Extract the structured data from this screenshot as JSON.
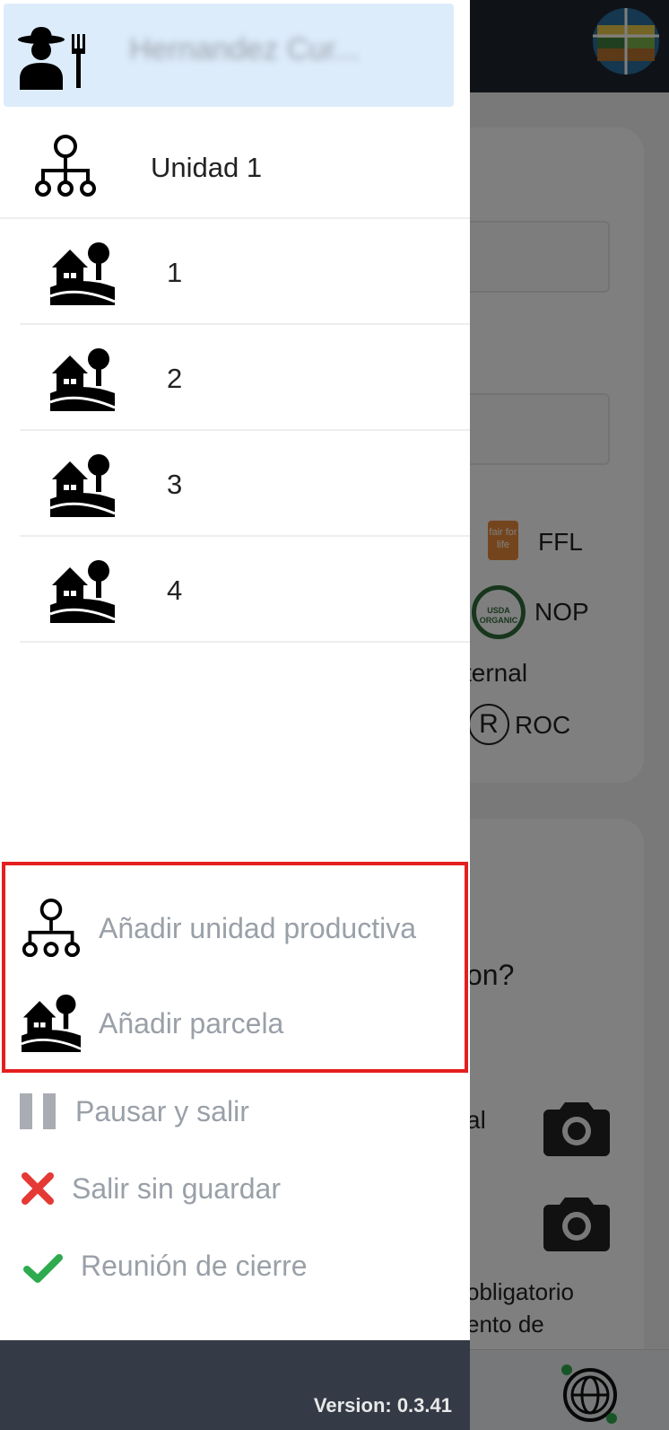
{
  "drawer": {
    "user_name": "Hernandez Cur...",
    "unit": {
      "label": "Unidad 1"
    },
    "plots": [
      {
        "label": "1"
      },
      {
        "label": "2"
      },
      {
        "label": "3"
      },
      {
        "label": "4"
      }
    ],
    "actions": {
      "add_unit": "Añadir unidad productiva",
      "add_plot": "Añadir parcela",
      "pause_exit": "Pausar y salir",
      "exit_no_save": "Salir sin guardar",
      "closing_meeting": "Reunión de cierre"
    },
    "version": "Version: 0.3.41"
  },
  "background": {
    "certifications": [
      {
        "label": "FFL",
        "badge_text": "fair for life"
      },
      {
        "label": "NOP",
        "badge_text": "USDA ORGANIC"
      },
      {
        "label": "ROC",
        "badge_text": "R"
      }
    ],
    "partial_texts": {
      "internal": "ternal",
      "question": "on?",
      "al": "al",
      "obligatorio": "obligatorio",
      "ento_de": "ento de"
    }
  },
  "colors": {
    "highlight": "#e41f1f",
    "drawer_header_bg": "#ddecfb",
    "version_bar_bg": "#343a46",
    "exit_icon": "#e53935",
    "check_icon": "#2eaa4f"
  },
  "icons": {
    "avatar": "farmer-icon",
    "unit": "org-tree-icon",
    "plot": "farm-plot-icon",
    "pause": "pause-icon",
    "exit": "close-icon",
    "closing": "check-icon",
    "camera": "camera-icon",
    "globe": "globe-map-icon"
  }
}
